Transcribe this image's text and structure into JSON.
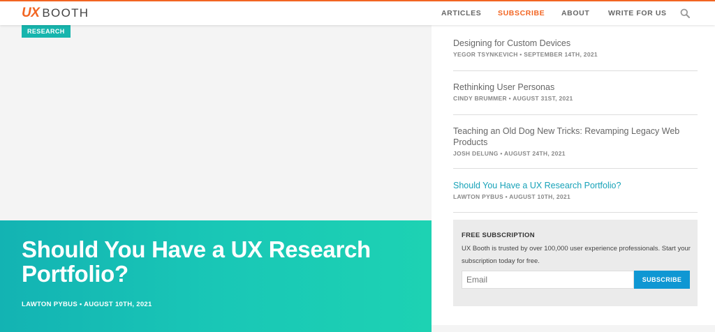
{
  "header": {
    "logo_ux": "UX",
    "logo_booth": "BOOTH",
    "nav": [
      {
        "label": "ARTICLES",
        "accent": false
      },
      {
        "label": "SUBSCRIBE",
        "accent": true
      },
      {
        "label": "ABOUT",
        "accent": false
      },
      {
        "label": "WRITE FOR US",
        "accent": false
      }
    ],
    "search_icon": "search-icon"
  },
  "hero": {
    "category": "RESEARCH",
    "title": "Should You Have a UX Research Portfolio?",
    "meta": "LAWTON PYBUS • AUGUST 10TH, 2021"
  },
  "sidebar": {
    "articles": [
      {
        "title": "Designing for Custom Devices",
        "meta": "YEGOR TSYNKEVICH • SEPTEMBER 14TH, 2021",
        "active": false
      },
      {
        "title": "Rethinking User Personas",
        "meta": "CINDY BRUMMER • AUGUST 31ST, 2021",
        "active": false
      },
      {
        "title": "Teaching an Old Dog New Tricks: Revamping Legacy Web Products",
        "meta": "JOSH DELUNG • AUGUST 24TH, 2021",
        "active": false
      },
      {
        "title": "Should You Have a UX Research Portfolio?",
        "meta": "LAWTON PYBUS • AUGUST 10TH, 2021",
        "active": true
      }
    ],
    "subscription": {
      "heading": "FREE SUBSCRIPTION",
      "text": "UX Booth is trusted by over 100,000 user experience professionals. Start your subscription today for free.",
      "email_placeholder": "Email",
      "button_label": "SUBSCRIBE"
    }
  },
  "colors": {
    "brand": "#f26522",
    "teal": "#17b5ad",
    "link_active": "#17a2b8",
    "button": "#0f97d3"
  }
}
